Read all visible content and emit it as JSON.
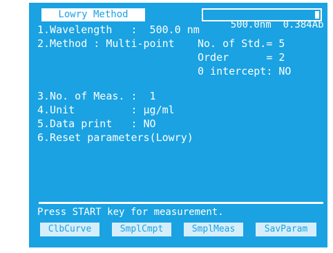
{
  "header": {
    "title": "Lowry Method",
    "readout": "500.0nm  0.384Ab"
  },
  "params": {
    "wavelength": "1.Wavelength   :  500.0 nm",
    "method": "2.Method : Multi-point",
    "no_of_std": "No. of Std.= 5",
    "order": "Order      = 2",
    "zero_intercept": "0 intercept: NO",
    "no_of_meas": "3.No. of Meas. :  1",
    "unit": "4.Unit         : µg/ml",
    "data_print": "5.Data print   : NO",
    "reset": "6.Reset parameters(Lowry)"
  },
  "status": {
    "message": "Press START key for measurement."
  },
  "function_keys": [
    "ClbCurve",
    "SmplCmpt",
    "SmplMeas",
    "SavParam"
  ]
}
